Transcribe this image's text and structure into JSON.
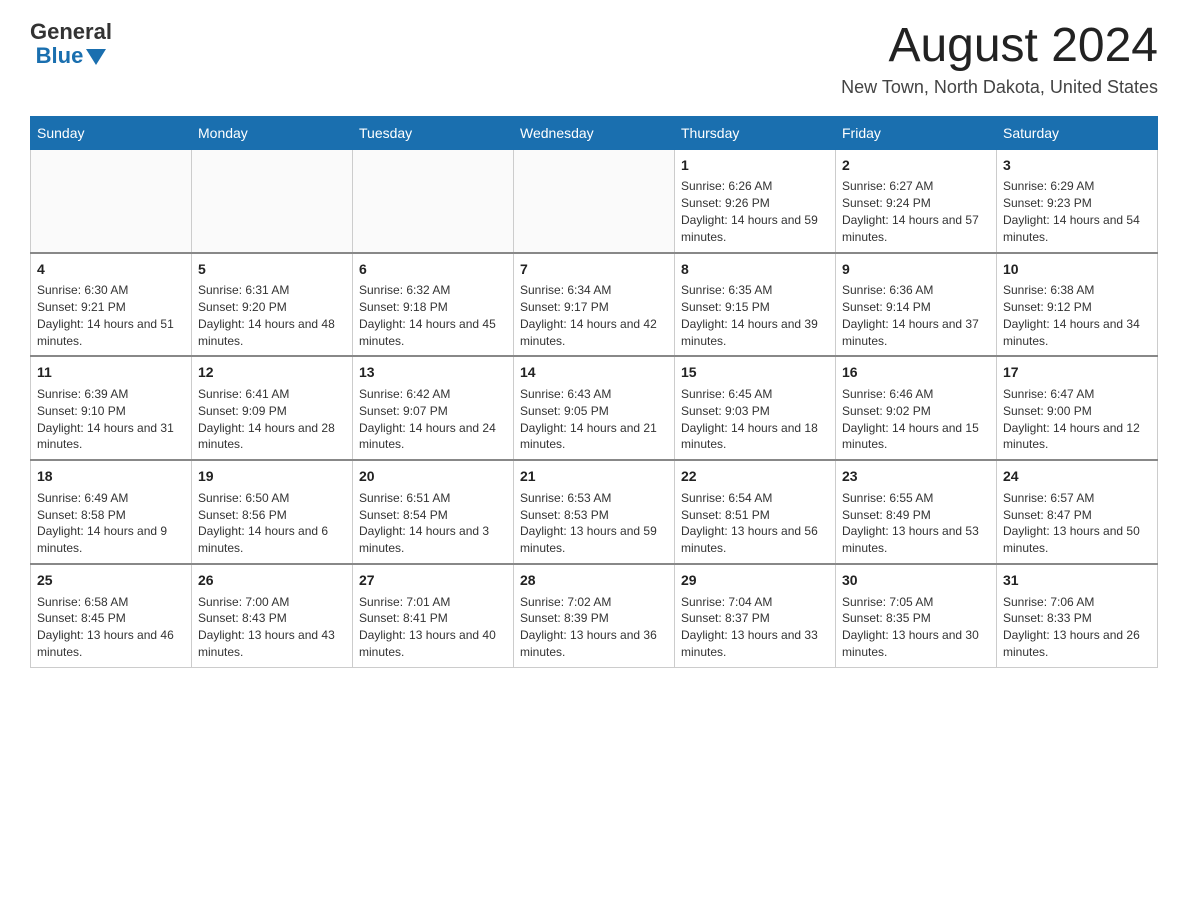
{
  "header": {
    "logo_general": "General",
    "logo_blue": "Blue",
    "title": "August 2024",
    "subtitle": "New Town, North Dakota, United States"
  },
  "days_of_week": [
    "Sunday",
    "Monday",
    "Tuesday",
    "Wednesday",
    "Thursday",
    "Friday",
    "Saturday"
  ],
  "weeks": [
    [
      {
        "day": "",
        "info": ""
      },
      {
        "day": "",
        "info": ""
      },
      {
        "day": "",
        "info": ""
      },
      {
        "day": "",
        "info": ""
      },
      {
        "day": "1",
        "info": "Sunrise: 6:26 AM\nSunset: 9:26 PM\nDaylight: 14 hours and 59 minutes."
      },
      {
        "day": "2",
        "info": "Sunrise: 6:27 AM\nSunset: 9:24 PM\nDaylight: 14 hours and 57 minutes."
      },
      {
        "day": "3",
        "info": "Sunrise: 6:29 AM\nSunset: 9:23 PM\nDaylight: 14 hours and 54 minutes."
      }
    ],
    [
      {
        "day": "4",
        "info": "Sunrise: 6:30 AM\nSunset: 9:21 PM\nDaylight: 14 hours and 51 minutes."
      },
      {
        "day": "5",
        "info": "Sunrise: 6:31 AM\nSunset: 9:20 PM\nDaylight: 14 hours and 48 minutes."
      },
      {
        "day": "6",
        "info": "Sunrise: 6:32 AM\nSunset: 9:18 PM\nDaylight: 14 hours and 45 minutes."
      },
      {
        "day": "7",
        "info": "Sunrise: 6:34 AM\nSunset: 9:17 PM\nDaylight: 14 hours and 42 minutes."
      },
      {
        "day": "8",
        "info": "Sunrise: 6:35 AM\nSunset: 9:15 PM\nDaylight: 14 hours and 39 minutes."
      },
      {
        "day": "9",
        "info": "Sunrise: 6:36 AM\nSunset: 9:14 PM\nDaylight: 14 hours and 37 minutes."
      },
      {
        "day": "10",
        "info": "Sunrise: 6:38 AM\nSunset: 9:12 PM\nDaylight: 14 hours and 34 minutes."
      }
    ],
    [
      {
        "day": "11",
        "info": "Sunrise: 6:39 AM\nSunset: 9:10 PM\nDaylight: 14 hours and 31 minutes."
      },
      {
        "day": "12",
        "info": "Sunrise: 6:41 AM\nSunset: 9:09 PM\nDaylight: 14 hours and 28 minutes."
      },
      {
        "day": "13",
        "info": "Sunrise: 6:42 AM\nSunset: 9:07 PM\nDaylight: 14 hours and 24 minutes."
      },
      {
        "day": "14",
        "info": "Sunrise: 6:43 AM\nSunset: 9:05 PM\nDaylight: 14 hours and 21 minutes."
      },
      {
        "day": "15",
        "info": "Sunrise: 6:45 AM\nSunset: 9:03 PM\nDaylight: 14 hours and 18 minutes."
      },
      {
        "day": "16",
        "info": "Sunrise: 6:46 AM\nSunset: 9:02 PM\nDaylight: 14 hours and 15 minutes."
      },
      {
        "day": "17",
        "info": "Sunrise: 6:47 AM\nSunset: 9:00 PM\nDaylight: 14 hours and 12 minutes."
      }
    ],
    [
      {
        "day": "18",
        "info": "Sunrise: 6:49 AM\nSunset: 8:58 PM\nDaylight: 14 hours and 9 minutes."
      },
      {
        "day": "19",
        "info": "Sunrise: 6:50 AM\nSunset: 8:56 PM\nDaylight: 14 hours and 6 minutes."
      },
      {
        "day": "20",
        "info": "Sunrise: 6:51 AM\nSunset: 8:54 PM\nDaylight: 14 hours and 3 minutes."
      },
      {
        "day": "21",
        "info": "Sunrise: 6:53 AM\nSunset: 8:53 PM\nDaylight: 13 hours and 59 minutes."
      },
      {
        "day": "22",
        "info": "Sunrise: 6:54 AM\nSunset: 8:51 PM\nDaylight: 13 hours and 56 minutes."
      },
      {
        "day": "23",
        "info": "Sunrise: 6:55 AM\nSunset: 8:49 PM\nDaylight: 13 hours and 53 minutes."
      },
      {
        "day": "24",
        "info": "Sunrise: 6:57 AM\nSunset: 8:47 PM\nDaylight: 13 hours and 50 minutes."
      }
    ],
    [
      {
        "day": "25",
        "info": "Sunrise: 6:58 AM\nSunset: 8:45 PM\nDaylight: 13 hours and 46 minutes."
      },
      {
        "day": "26",
        "info": "Sunrise: 7:00 AM\nSunset: 8:43 PM\nDaylight: 13 hours and 43 minutes."
      },
      {
        "day": "27",
        "info": "Sunrise: 7:01 AM\nSunset: 8:41 PM\nDaylight: 13 hours and 40 minutes."
      },
      {
        "day": "28",
        "info": "Sunrise: 7:02 AM\nSunset: 8:39 PM\nDaylight: 13 hours and 36 minutes."
      },
      {
        "day": "29",
        "info": "Sunrise: 7:04 AM\nSunset: 8:37 PM\nDaylight: 13 hours and 33 minutes."
      },
      {
        "day": "30",
        "info": "Sunrise: 7:05 AM\nSunset: 8:35 PM\nDaylight: 13 hours and 30 minutes."
      },
      {
        "day": "31",
        "info": "Sunrise: 7:06 AM\nSunset: 8:33 PM\nDaylight: 13 hours and 26 minutes."
      }
    ]
  ]
}
